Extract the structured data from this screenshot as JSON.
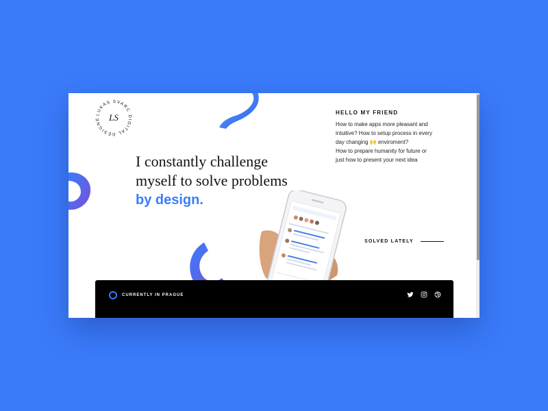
{
  "logo": {
    "ring_text": "LUKAS SVARC DIGITAL DESIGNER",
    "monogram": "LS"
  },
  "hero": {
    "line1": "I constantly challenge",
    "line2": "myself to solve problems",
    "accent": "by design."
  },
  "intro": {
    "title": "HELLO MY FRIEND",
    "line1": "How to make apps more pleasant and",
    "line2": "intuitive? How to setup process in every",
    "line3": "day changing 🙌 enviroment?",
    "line4": "How to prepare humanity for future or",
    "line5": "just how to present your next idea"
  },
  "solved": {
    "label": "SOLVED LATELY"
  },
  "footer": {
    "location": "CURRENTLY IN PRAGUE",
    "social": [
      "twitter-icon",
      "instagram-icon",
      "dribbble-icon"
    ]
  },
  "colors": {
    "background": "#3a7bfa",
    "accent": "#3a7bfa",
    "gradient_start": "#3a7bfa",
    "gradient_end": "#7a4fd8",
    "footer": "#000000"
  }
}
